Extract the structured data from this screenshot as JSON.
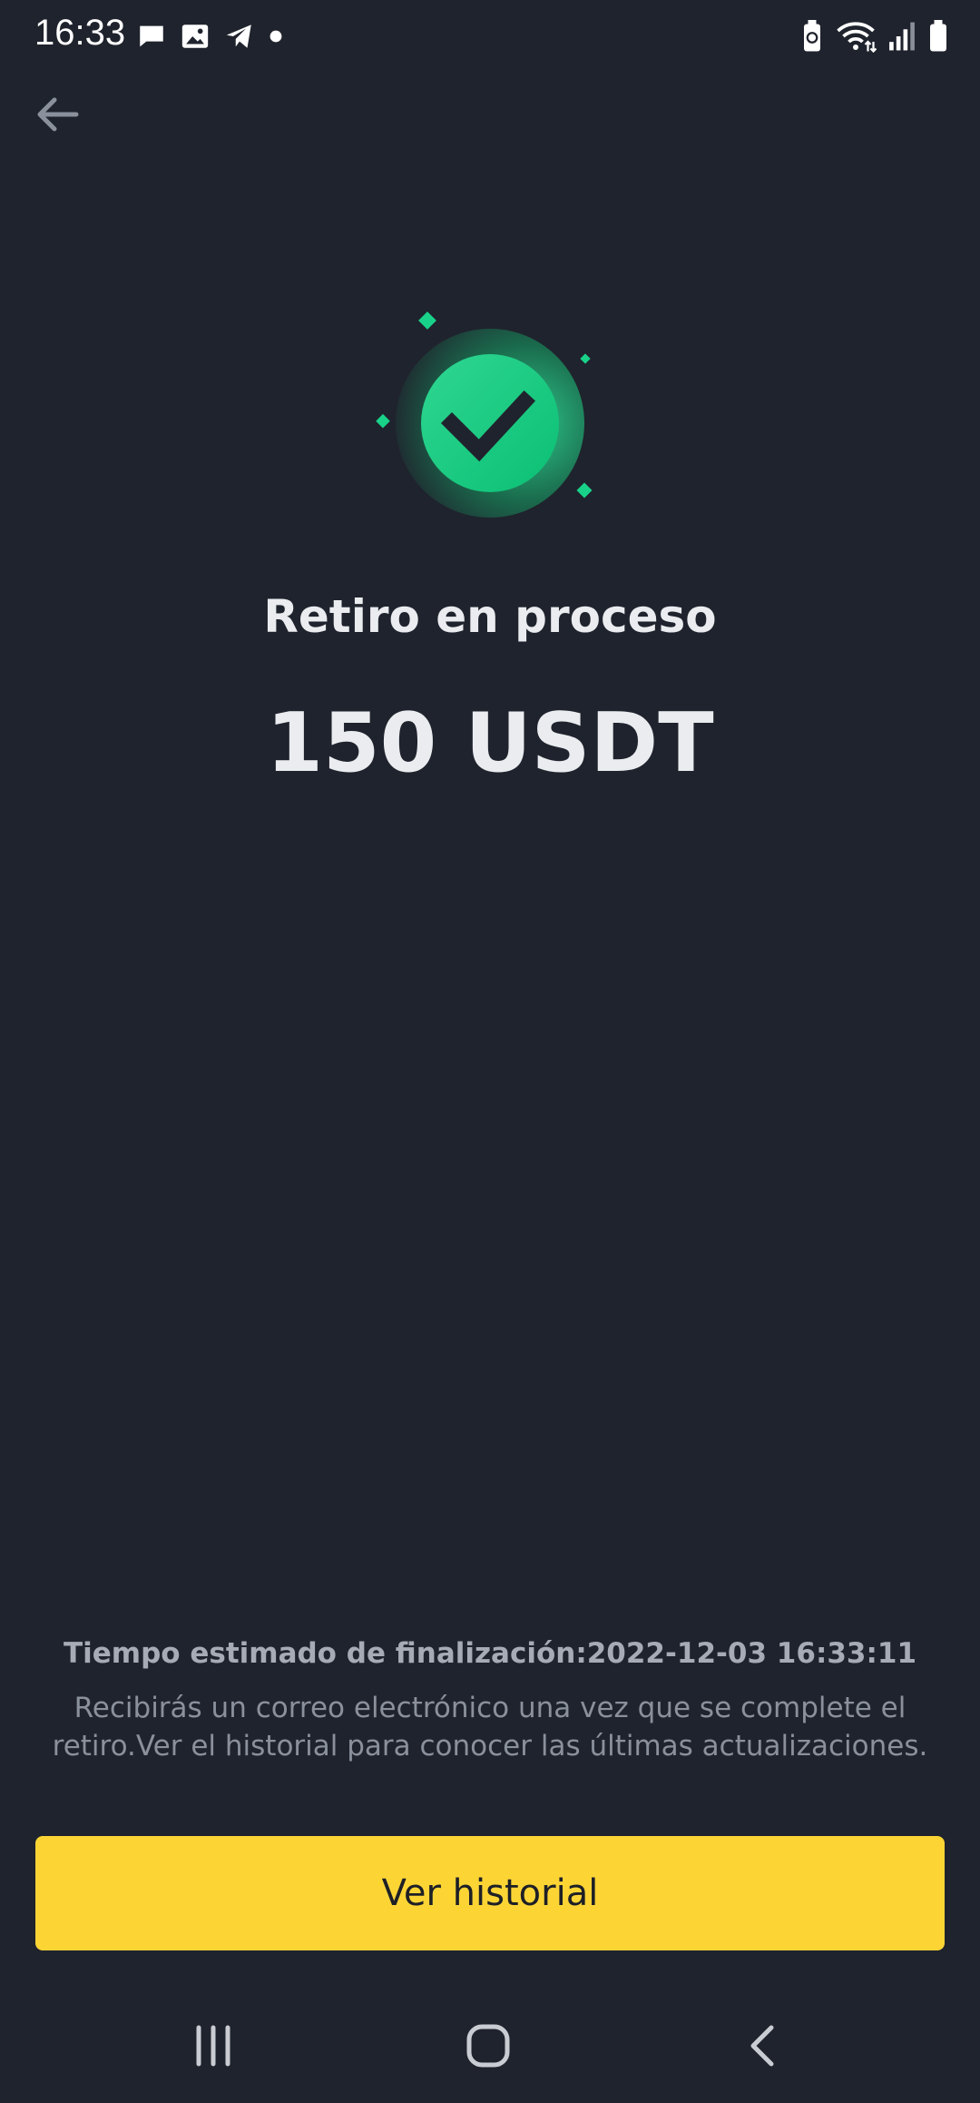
{
  "status_bar": {
    "time": "16:33",
    "left_icons": [
      "chat-icon",
      "image-icon",
      "telegram-icon",
      "dot-icon"
    ],
    "right_icons": [
      "battery-saver-icon",
      "wifi-icon",
      "signal-icon",
      "battery-icon"
    ]
  },
  "header": {
    "back_icon": "arrow-left-icon"
  },
  "main": {
    "title": "Retiro en proceso",
    "amount": "150 USDT",
    "success_icon": "check-icon"
  },
  "footer": {
    "eta_text": "Tiempo estimado de finalización:2022-12-03 16:33:11",
    "note_text": "Recibirás un correo electrónico una vez que se complete el retiro.Ver el historial para conocer las últimas actualizaciones.",
    "button_label": "Ver historial"
  },
  "nav_bar": {
    "icons": [
      "recents-icon",
      "home-icon",
      "back-icon"
    ]
  },
  "colors": {
    "background": "#1f232d",
    "accent": "#fcd535",
    "success": "#0ecb81",
    "text_primary": "#eaecef",
    "text_secondary": "#8a909c"
  }
}
